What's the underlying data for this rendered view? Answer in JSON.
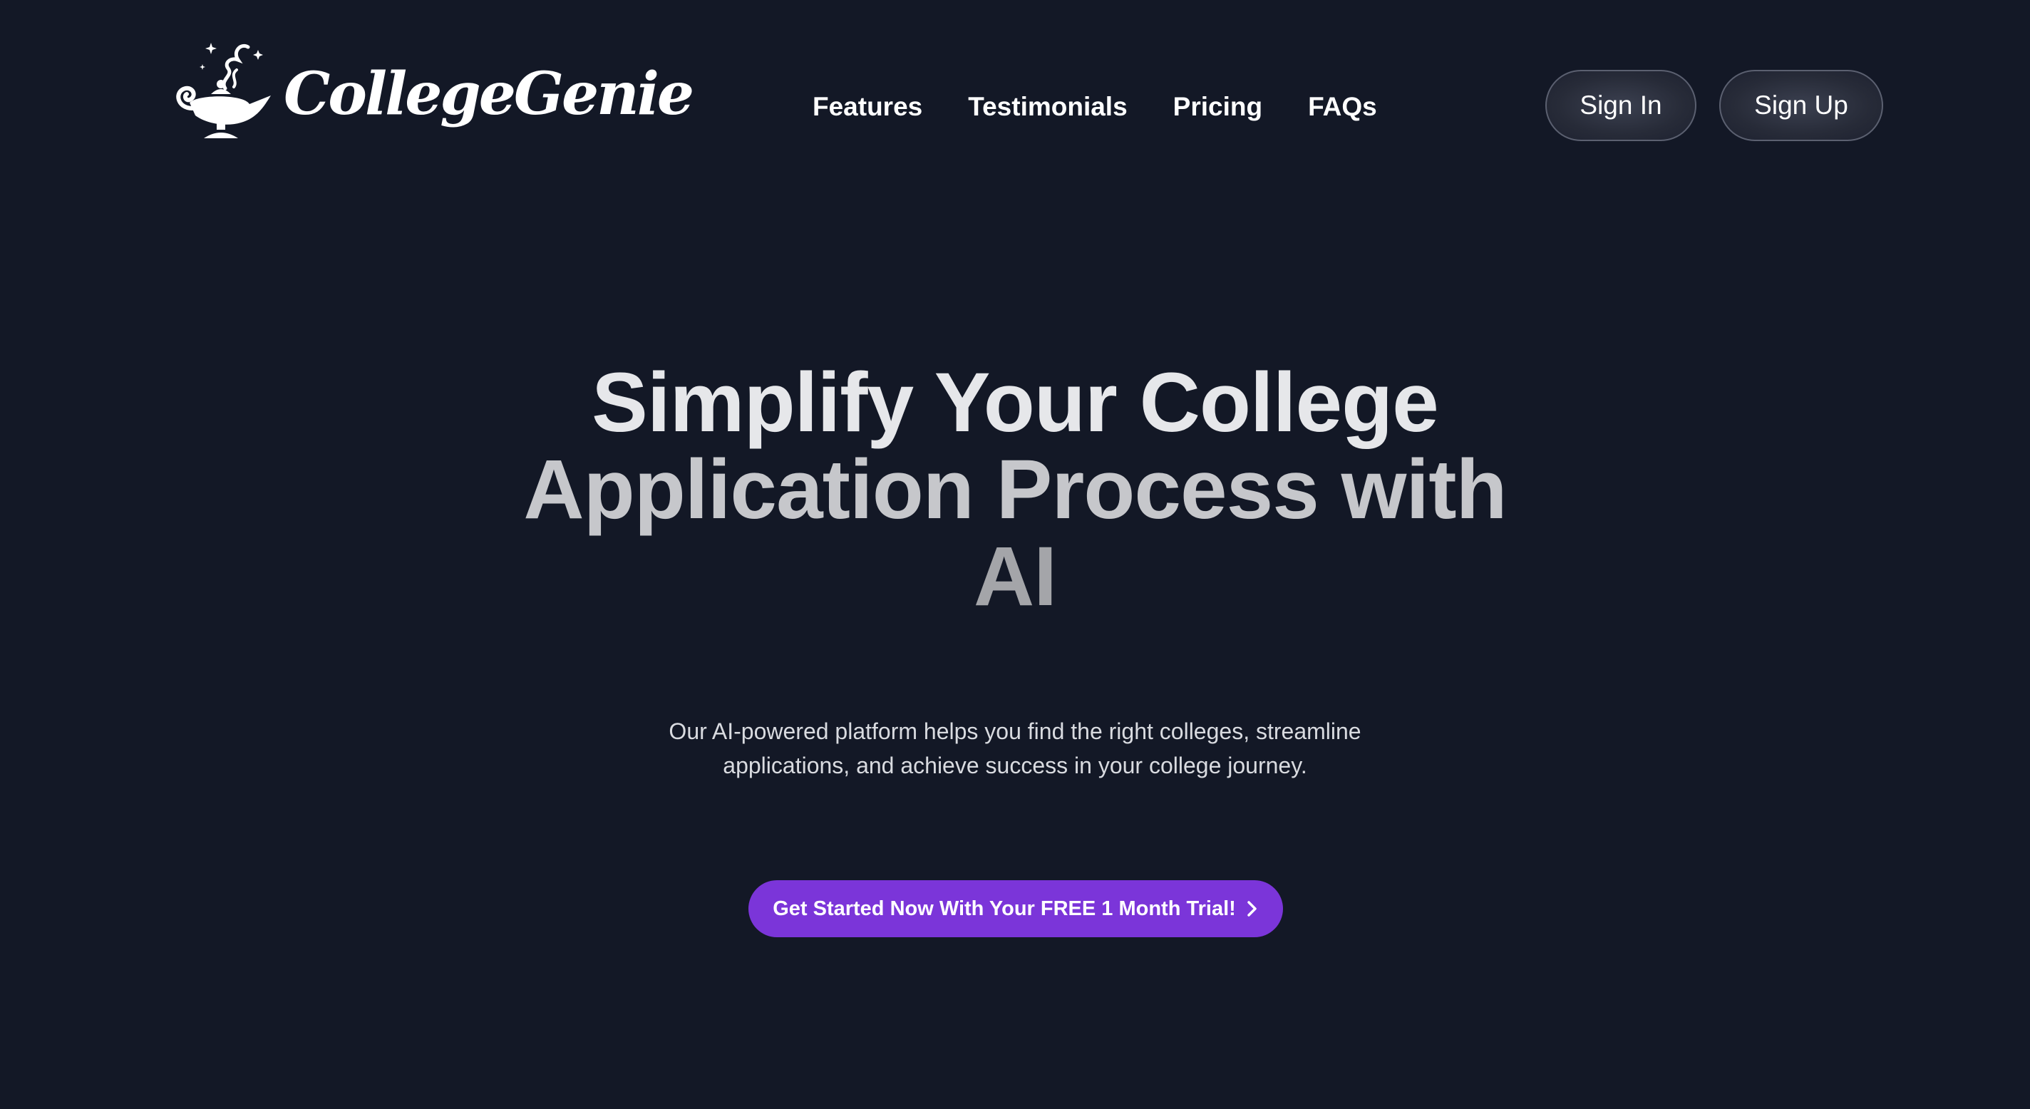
{
  "header": {
    "logo_text": "CollegeGenie",
    "logo_icon": "genie-lamp-icon",
    "nav": [
      {
        "label": "Features"
      },
      {
        "label": "Testimonials"
      },
      {
        "label": "Pricing"
      },
      {
        "label": "FAQs"
      }
    ],
    "sign_in_label": "Sign In",
    "sign_up_label": "Sign Up"
  },
  "hero": {
    "title_lines": [
      "Simplify Your College",
      "Application Process with",
      "AI"
    ],
    "subtitle_lines": [
      "Our AI-powered platform helps you find the right colleges, streamline",
      "applications, and achieve success in your college journey."
    ],
    "cta_label": "Get Started Now With Your FREE 1 Month Trial!",
    "cta_icon": "chevron-right-icon"
  },
  "colors": {
    "background": "#131826",
    "cta": "#7b35d9",
    "text": "#ffffff"
  }
}
